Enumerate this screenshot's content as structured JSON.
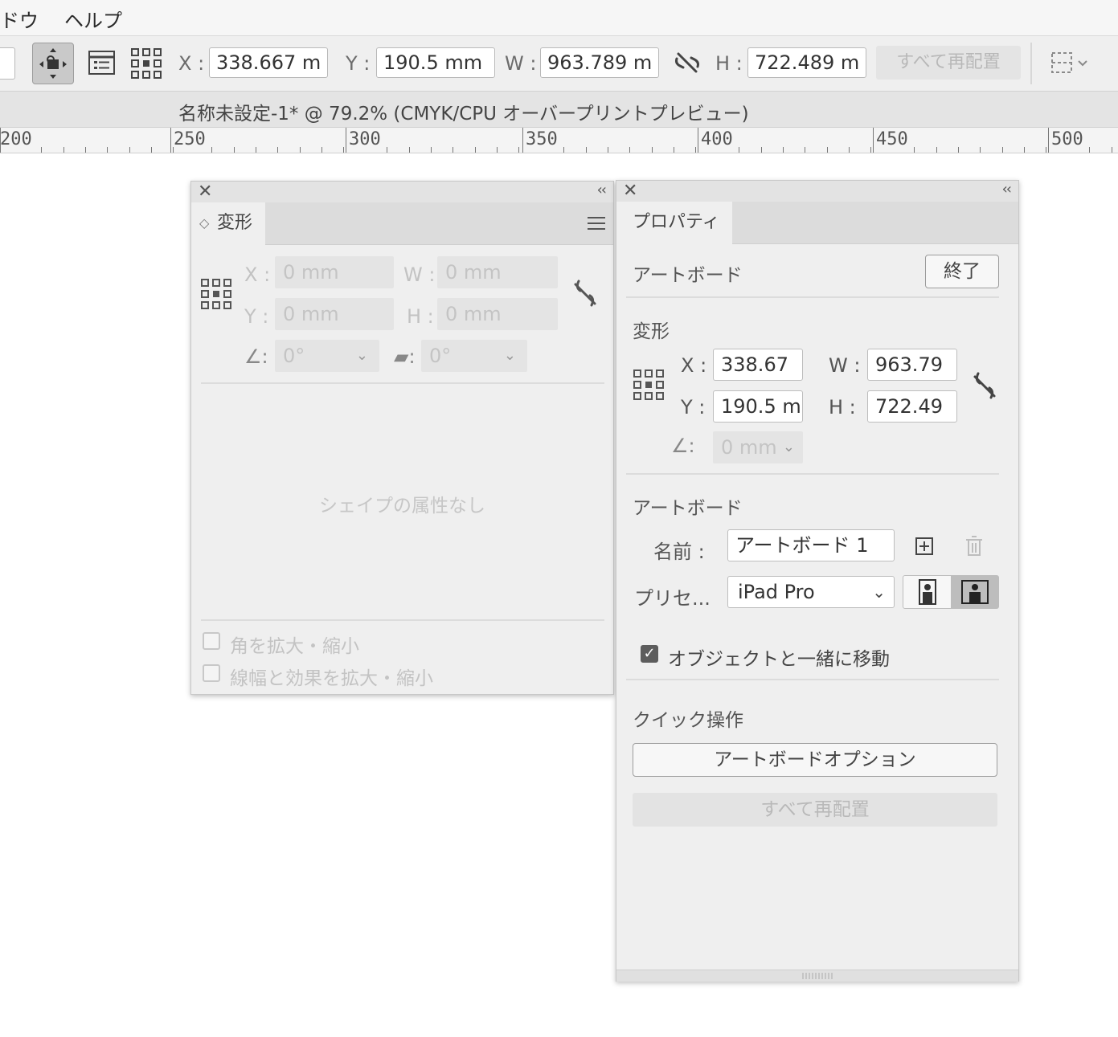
{
  "menubar": {
    "items": [
      "ドウ",
      "ヘルプ"
    ]
  },
  "controlbar": {
    "x_label": "X :",
    "x_value": "338.667 m",
    "y_label": "Y :",
    "y_value": "190.5 mm",
    "w_label": "W :",
    "w_value": "963.789 m",
    "h_label": "H :",
    "h_value": "722.489 m",
    "rearrange_all": "すべて再配置"
  },
  "document": {
    "title": "名称未設定-1* @ 79.2% (CMYK/CPU オーバープリントプレビュー)"
  },
  "ruler": {
    "labels": [
      "200",
      "250",
      "300",
      "350",
      "400",
      "450",
      "500"
    ]
  },
  "transform_panel": {
    "tab_label": "変形",
    "x_label": "X :",
    "x_value": "0 mm",
    "w_label": "W :",
    "w_value": "0 mm",
    "y_label": "Y :",
    "y_value": "0 mm",
    "h_label": "H :",
    "h_value": "0 mm",
    "angle_value": "0°",
    "shear_value": "0°",
    "no_shape_props": "シェイプの属性なし",
    "scale_corners": "角を拡大・縮小",
    "scale_strokes": "線幅と効果を拡大・縮小"
  },
  "properties_panel": {
    "tab_label": "プロパティ",
    "artboard_header": "アートボード",
    "done_button": "終了",
    "transform_title": "変形",
    "x_label": "X :",
    "x_value": "338.67",
    "w_label": "W :",
    "w_value": "963.79",
    "y_label": "Y :",
    "y_value": "190.5 m",
    "h_label": "H :",
    "h_value": "722.49",
    "rotate_value": "0 mm",
    "artboard_section_title": "アートボード",
    "name_label": "名前 :",
    "name_value": "アートボード 1",
    "preset_label": "プリセ...",
    "preset_value": "iPad Pro",
    "move_with_objects": "オブジェクトと一緒に移動",
    "quick_actions_title": "クイック操作",
    "artboard_options_button": "アートボードオプション",
    "rearrange_all_button": "すべて再配置"
  },
  "colors": {
    "panel_bg": "#efefef",
    "field_bg": "#ffffff",
    "disabled_text": "#c4c4c4",
    "accent_checkbox": "#5d5d5d"
  }
}
